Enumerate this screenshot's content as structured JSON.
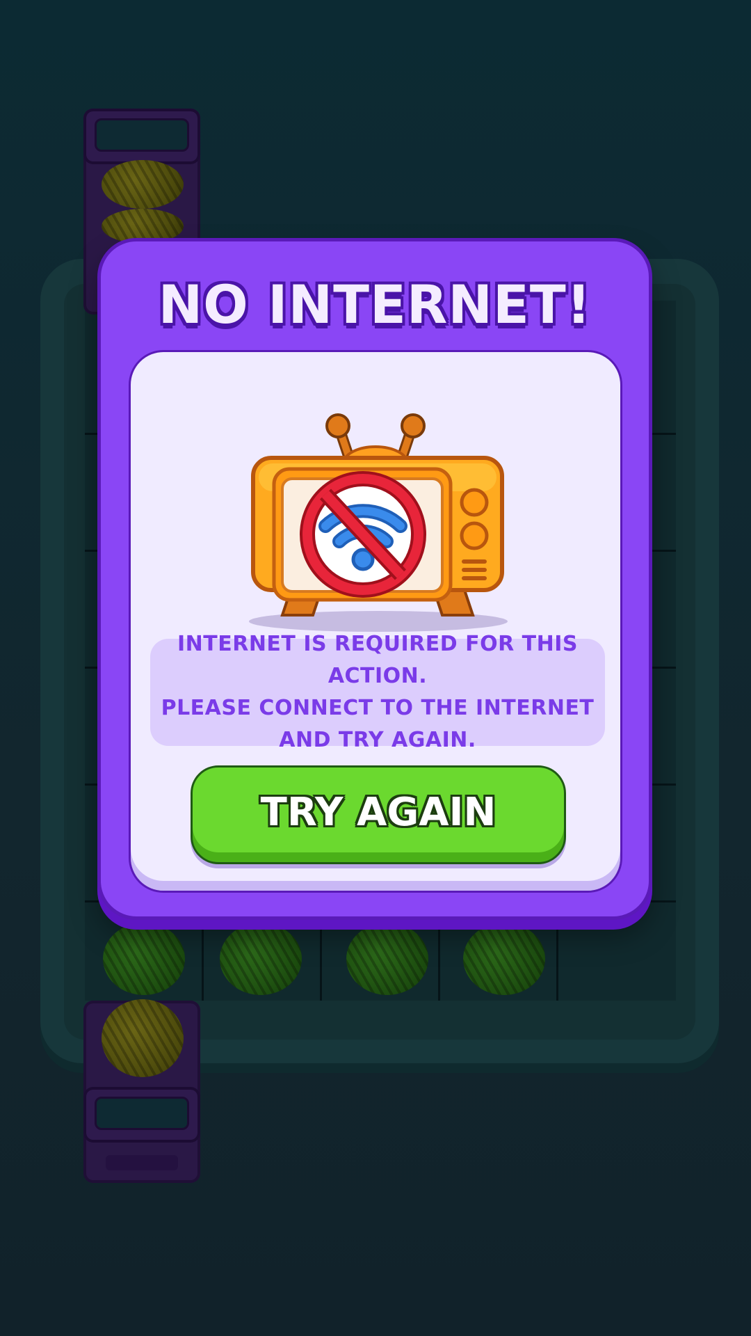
{
  "modal": {
    "title": "NO INTERNET!",
    "message_lines": [
      "INTERNET IS REQUIRED FOR THIS ACTION.",
      "PLEASE CONNECT TO THE INTERNET",
      "AND TRY AGAIN."
    ],
    "button_label": "TRY AGAIN",
    "icons": [
      "retro-tv-icon",
      "no-wifi-icon"
    ]
  },
  "colors": {
    "modal_purple": "#8a46f5",
    "button_green": "#6bd92f",
    "message_text": "#7a3be8",
    "background": "#0c2a33"
  }
}
